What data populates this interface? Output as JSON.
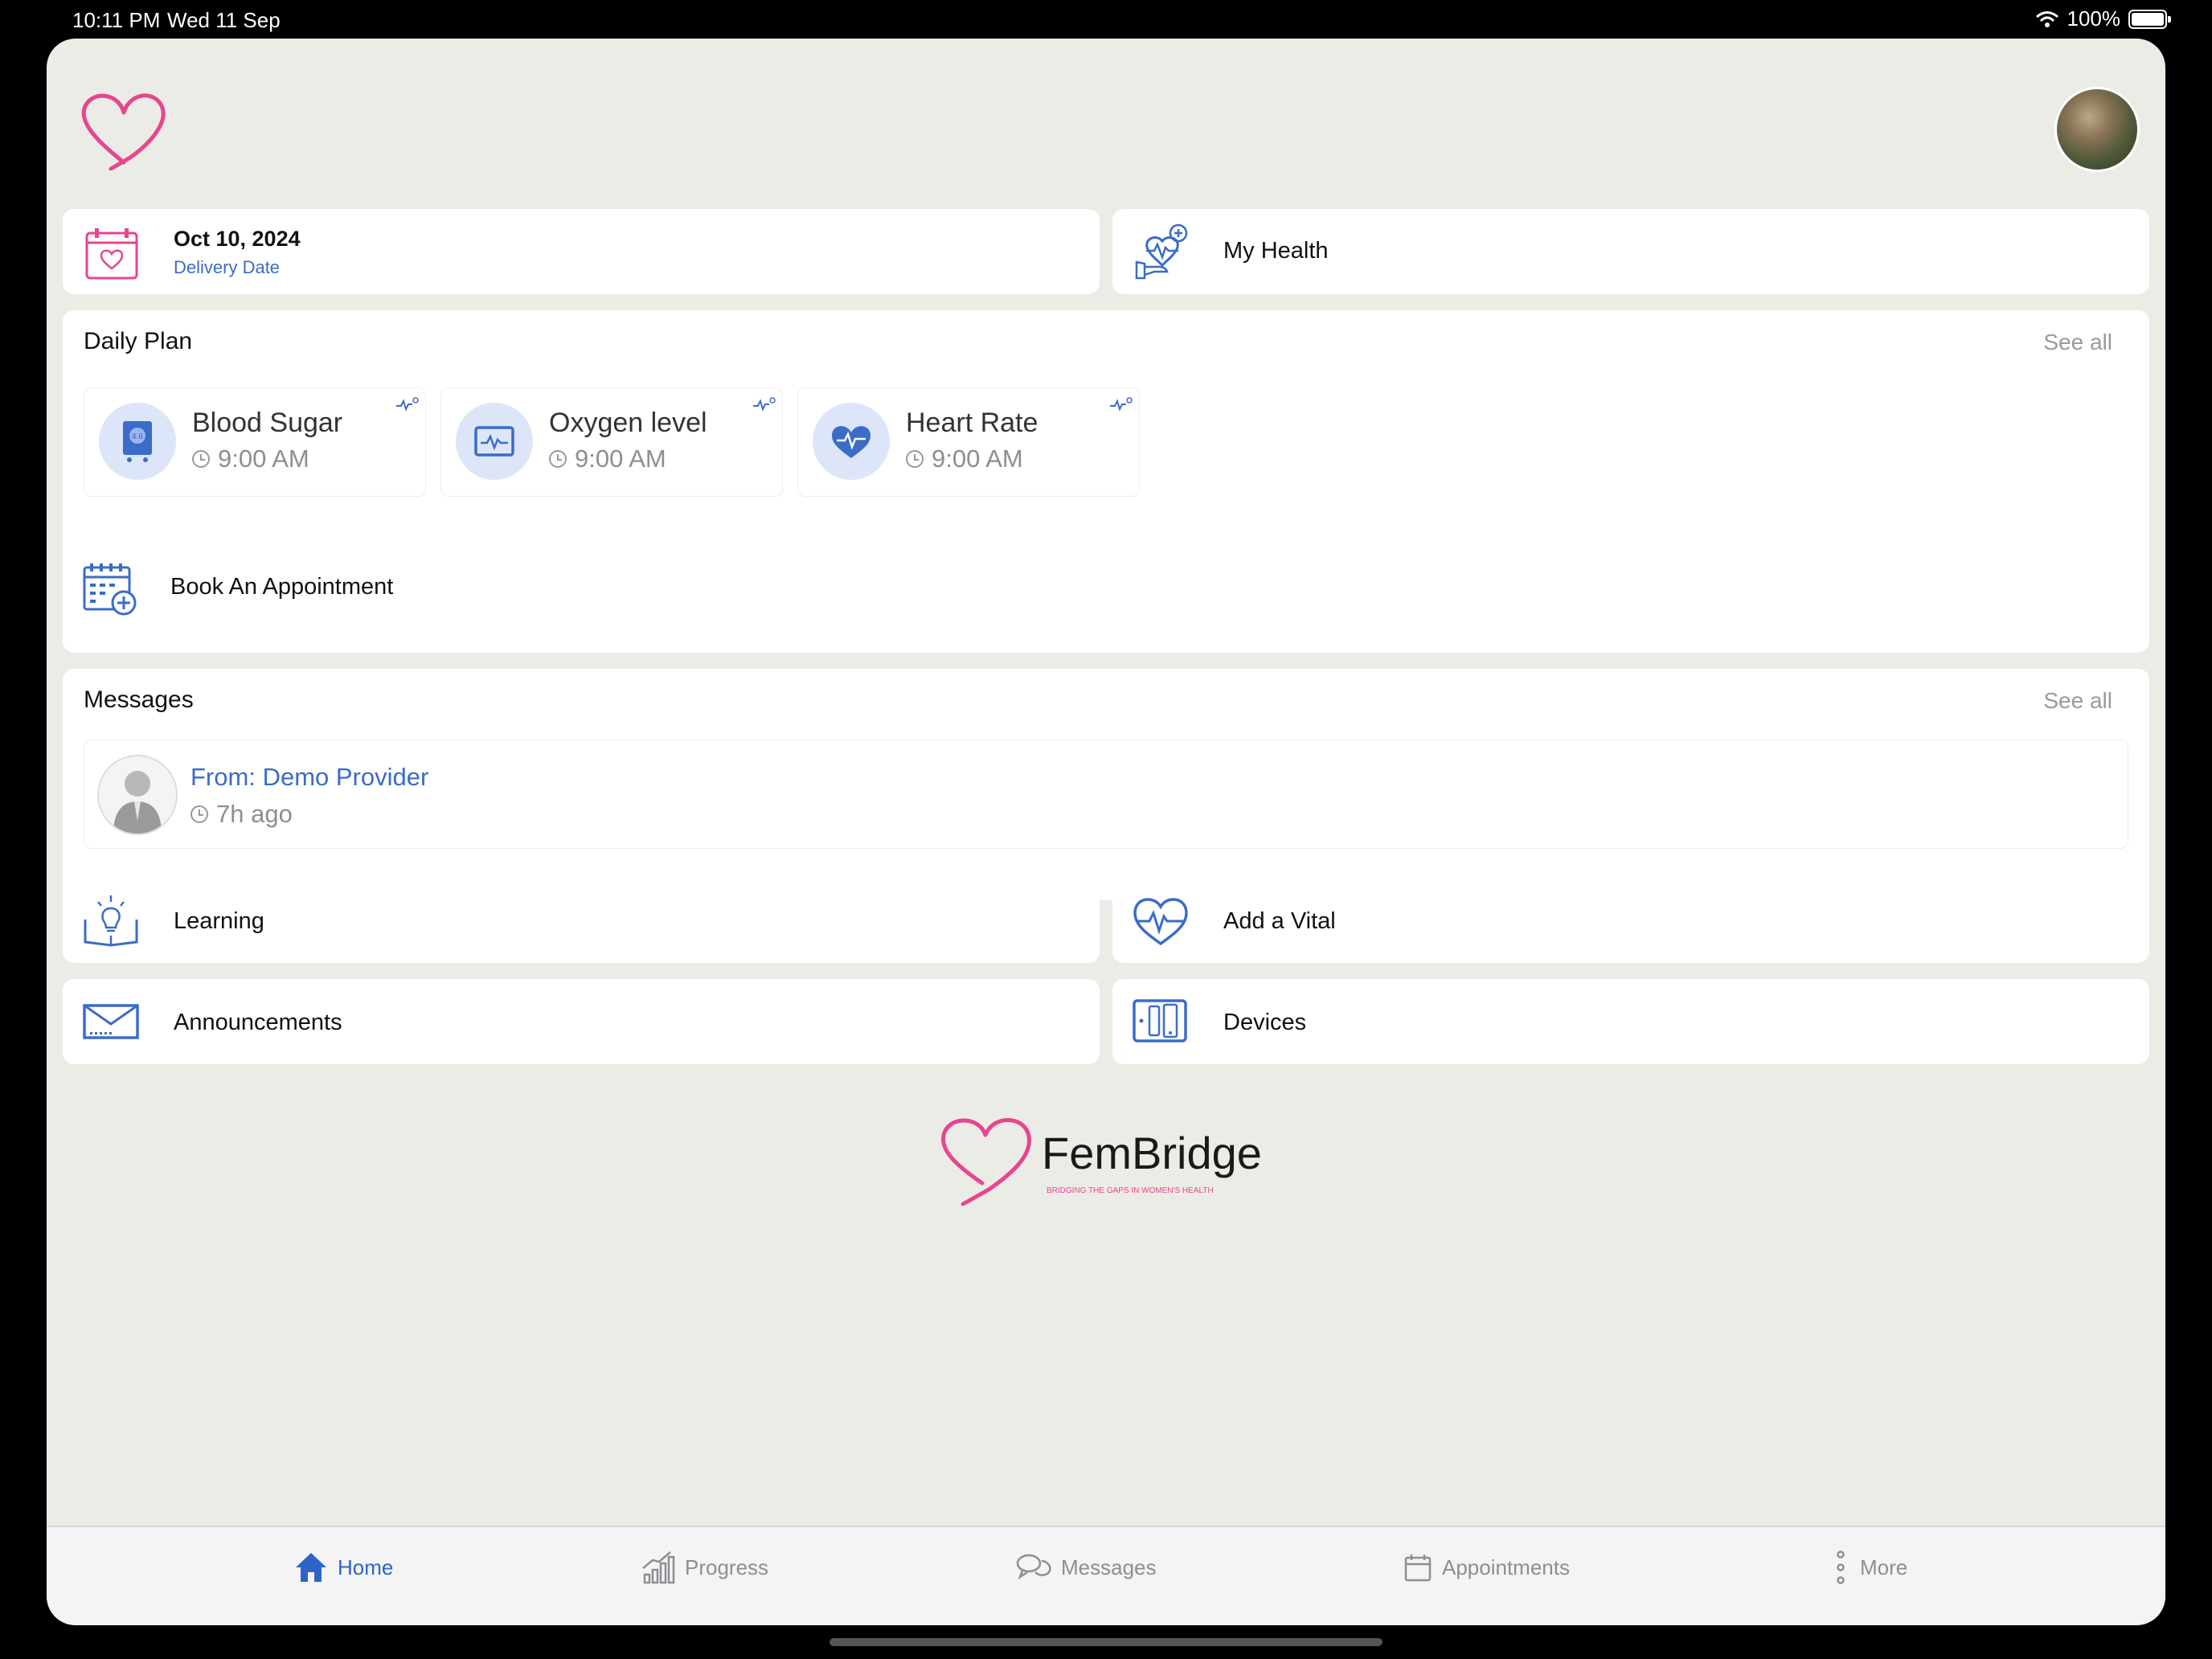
{
  "status_bar": {
    "time": "10:11 PM",
    "date": "Wed 11 Sep",
    "battery": "100%",
    "battery_level": 1.0
  },
  "delivery": {
    "date": "Oct 10, 2024",
    "label": "Delivery Date"
  },
  "my_health": {
    "label": "My Health"
  },
  "daily_plan": {
    "title": "Daily Plan",
    "see_all": "See all",
    "items": [
      {
        "title": "Blood Sugar",
        "time": "9:00 AM",
        "icon": "blood-sugar-meter-icon"
      },
      {
        "title": "Oxygen level",
        "time": "9:00 AM",
        "icon": "oxygen-monitor-icon"
      },
      {
        "title": "Heart Rate",
        "time": "9:00 AM",
        "icon": "heart-rate-icon"
      }
    ]
  },
  "book_appointment": {
    "label": "Book An Appointment"
  },
  "messages": {
    "title": "Messages",
    "see_all": "See all",
    "items": [
      {
        "from_label": "From:",
        "from": "Demo Provider",
        "time": "7h ago"
      }
    ]
  },
  "quick_links": {
    "learning": "Learning",
    "add_vital": "Add a Vital",
    "announcements": "Announcements",
    "devices": "Devices"
  },
  "brand": {
    "name": "FemBridge",
    "tagline": "BRIDGING THE GAPS IN WOMEN'S HEALTH"
  },
  "tabs": [
    {
      "label": "Home",
      "icon": "home-icon",
      "active": true
    },
    {
      "label": "Progress",
      "icon": "progress-chart-icon",
      "active": false
    },
    {
      "label": "Messages",
      "icon": "chat-bubbles-icon",
      "active": false
    },
    {
      "label": "Appointments",
      "icon": "calendar-icon",
      "active": false
    },
    {
      "label": "More",
      "icon": "more-dots-icon",
      "active": false
    }
  ],
  "colors": {
    "accent": "#3a6cc8",
    "brand_pink": "#e8458f",
    "background": "#ecece7"
  }
}
